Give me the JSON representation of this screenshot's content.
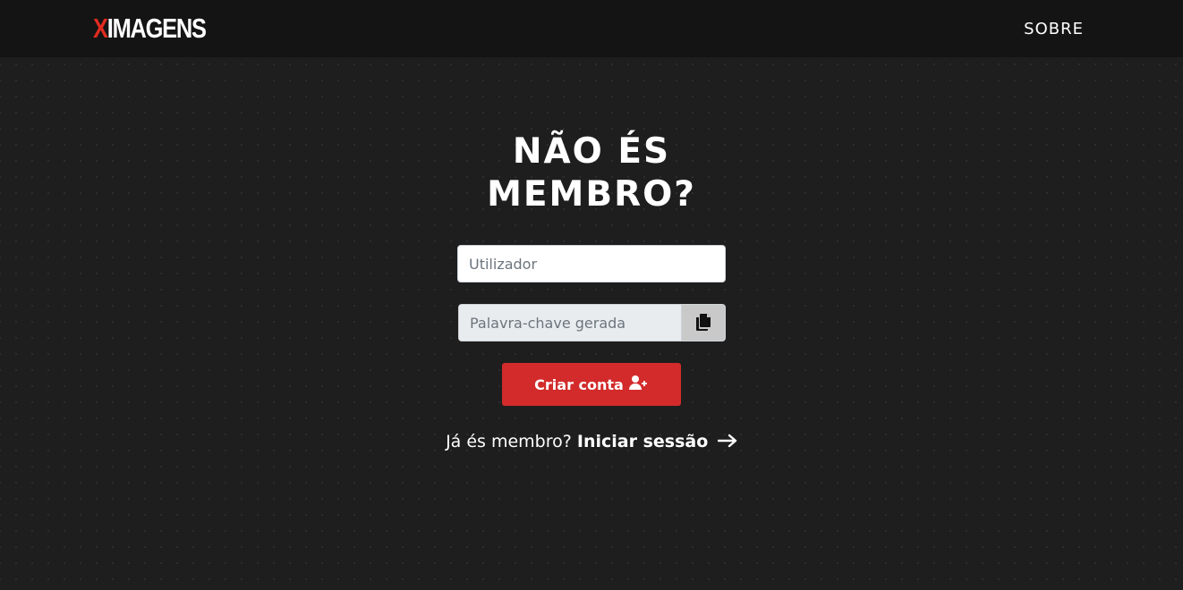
{
  "navbar": {
    "brand_x": "X",
    "brand_rest": "IMAGENS",
    "about_link": "SOBRE"
  },
  "form": {
    "heading_line1": "NÃO ÉS",
    "heading_line2": "MEMBRO?",
    "username_placeholder": "Utilizador",
    "password_placeholder": "Palavra-chave gerada",
    "copy_icon": "copy-icon",
    "create_button_label": "Criar conta",
    "create_button_icon": "user-plus-icon"
  },
  "login": {
    "prompt": "Já és membro?",
    "link_label": "Iniciar sessão",
    "link_icon": "arrow-right-icon"
  },
  "colors": {
    "background": "#1e1e1e",
    "navbar": "#141414",
    "accent": "#d32b2b",
    "brand_x": "#e02b20"
  }
}
